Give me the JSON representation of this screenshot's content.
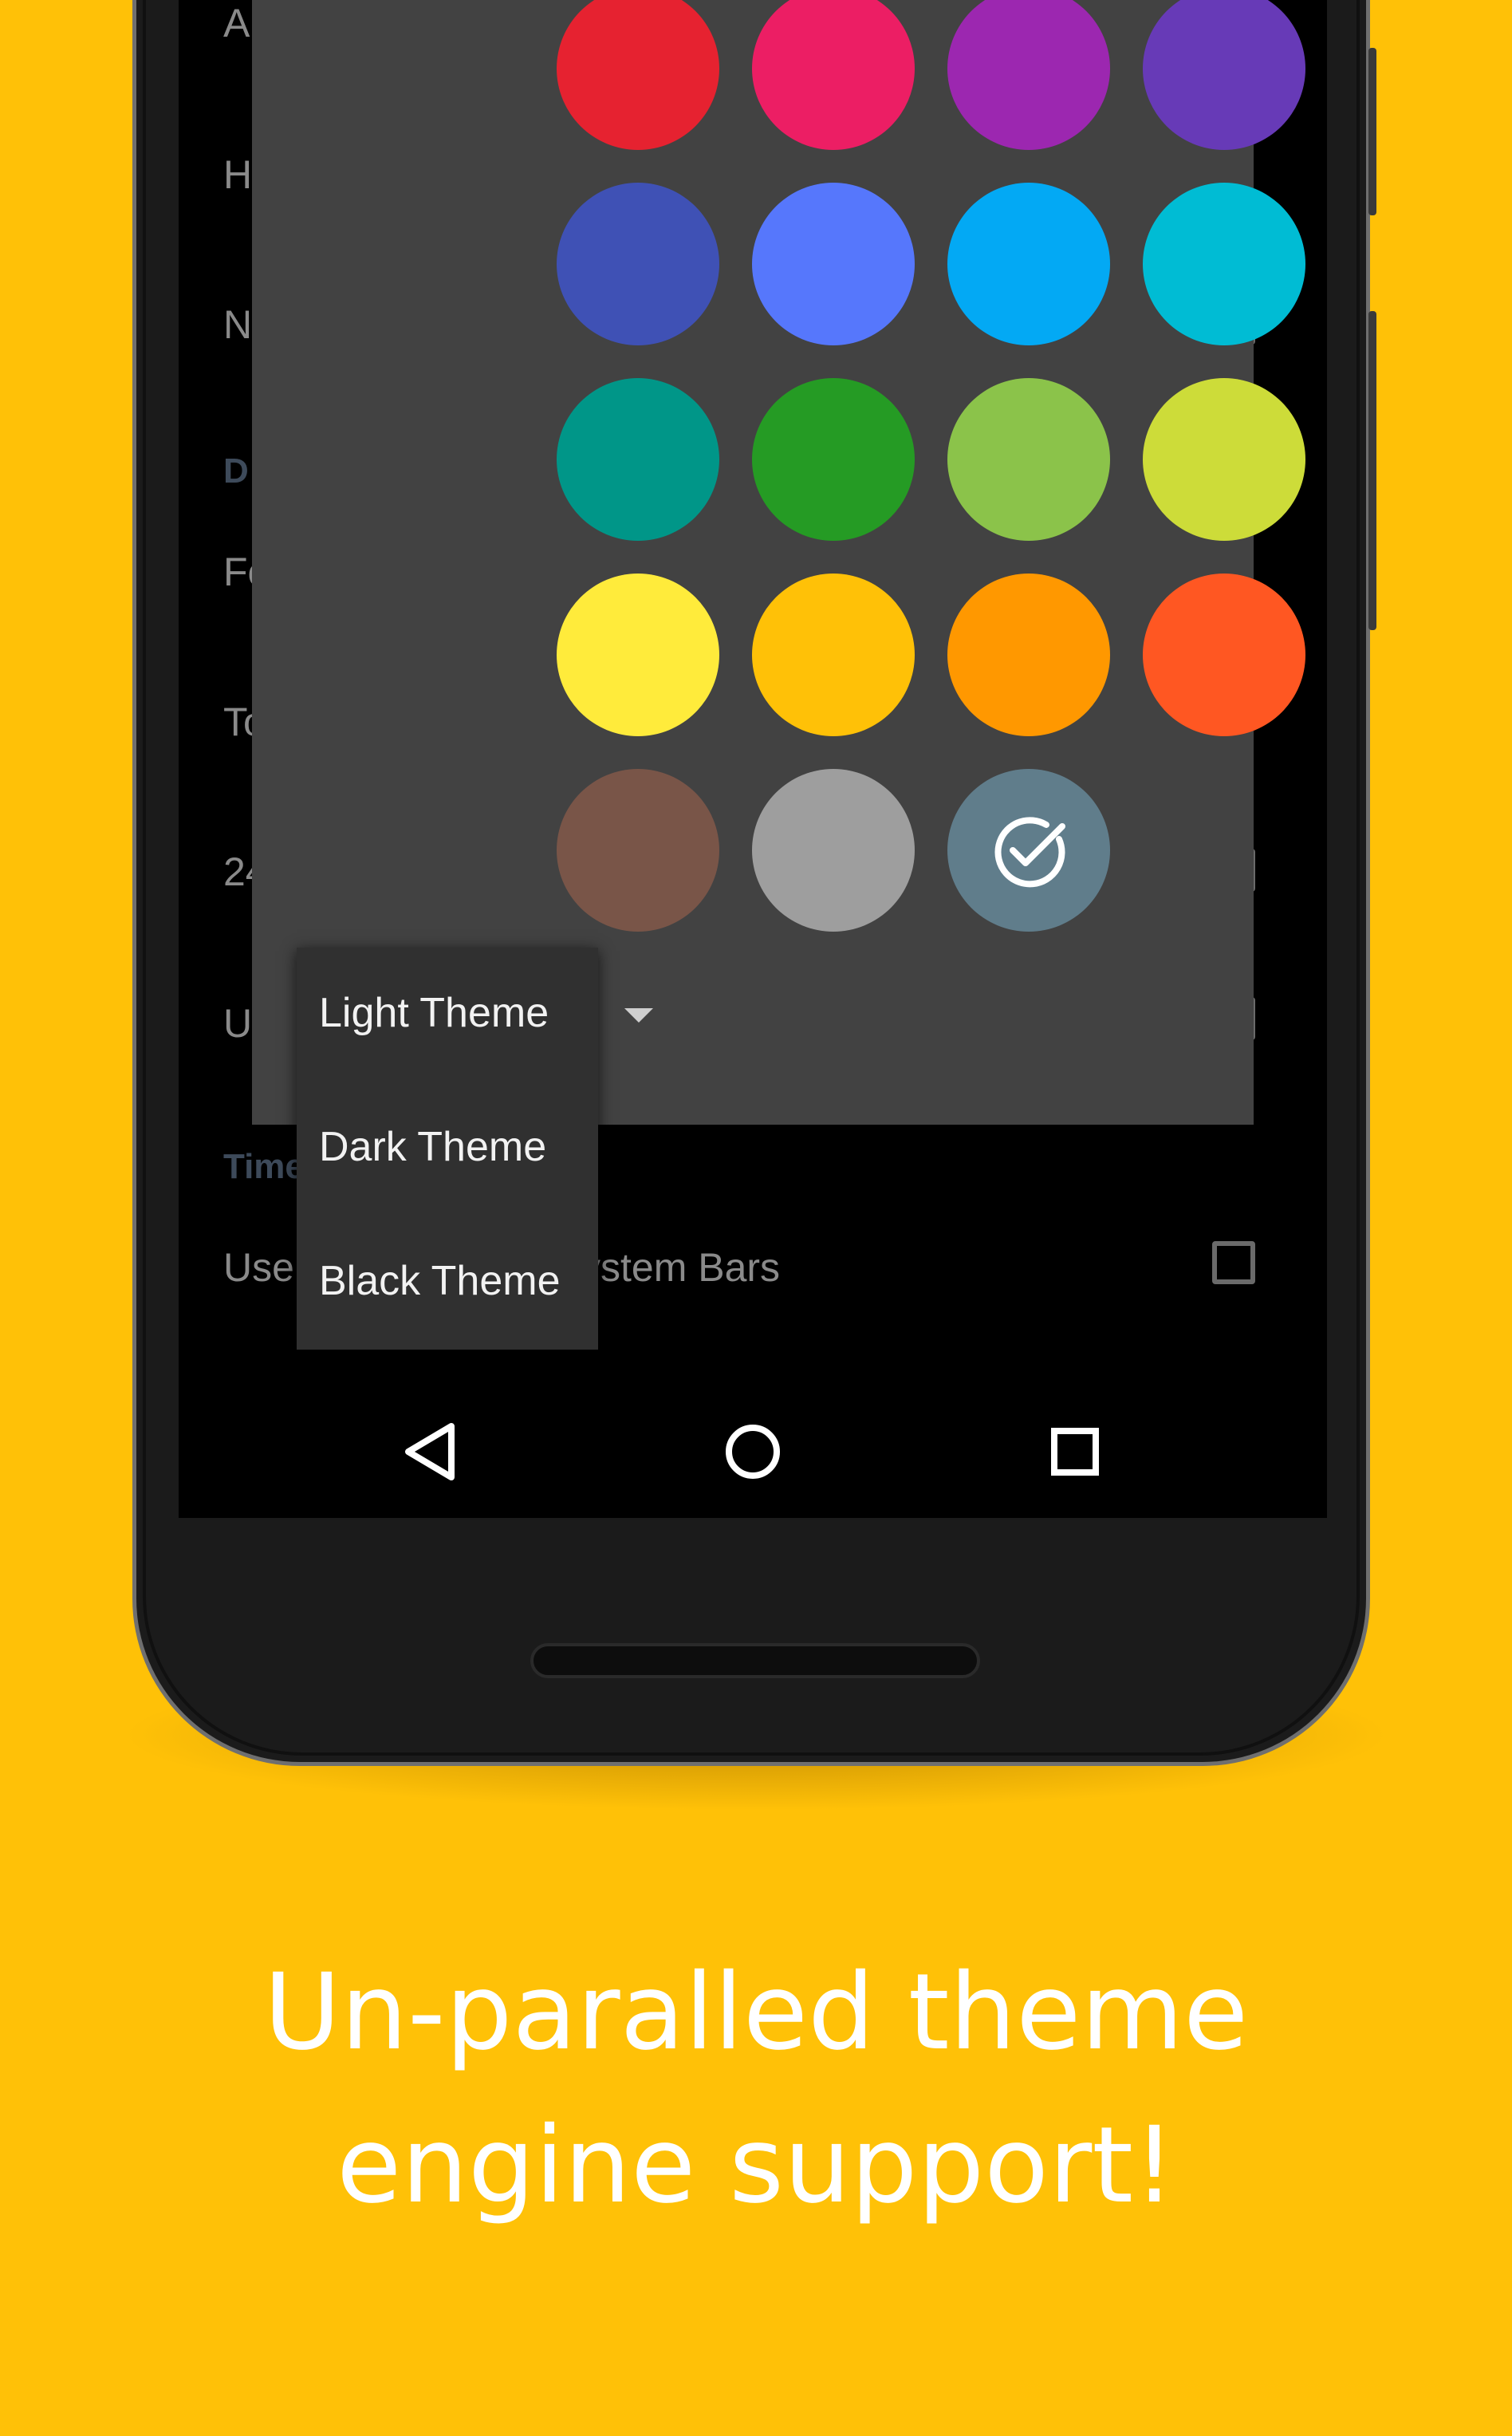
{
  "colors": {
    "background": "#FFC107",
    "dialog": "#424242",
    "menu": "#303030",
    "caption": "#FFFFFF"
  },
  "background_settings": {
    "rows": [
      {
        "text": "A"
      },
      {
        "text": "H"
      },
      {
        "text": "N"
      },
      {
        "text": "D"
      },
      {
        "text": "Fo"
      },
      {
        "text": "To"
      },
      {
        "text": "24"
      },
      {
        "text": "U"
      },
      {
        "text": "Time"
      },
      {
        "text": "Use",
        "suffix": "ystem Bars"
      }
    ]
  },
  "palette": {
    "swatches": [
      {
        "color": "#E62230",
        "name": "red"
      },
      {
        "color": "#EC1E64",
        "name": "pink"
      },
      {
        "color": "#9C27B0",
        "name": "purple"
      },
      {
        "color": "#673AB7",
        "name": "deep-purple"
      },
      {
        "color": "#3F51B5",
        "name": "indigo"
      },
      {
        "color": "#5677FC",
        "name": "blue"
      },
      {
        "color": "#03A9F4",
        "name": "light-blue"
      },
      {
        "color": "#00BCD4",
        "name": "cyan"
      },
      {
        "color": "#009688",
        "name": "teal"
      },
      {
        "color": "#259B24",
        "name": "green"
      },
      {
        "color": "#8BC34A",
        "name": "light-green"
      },
      {
        "color": "#CDDC39",
        "name": "lime"
      },
      {
        "color": "#FFEB3B",
        "name": "yellow"
      },
      {
        "color": "#FFC107",
        "name": "amber"
      },
      {
        "color": "#FF9800",
        "name": "orange"
      },
      {
        "color": "#FF5722",
        "name": "deep-orange"
      },
      {
        "color": "#795548",
        "name": "brown"
      },
      {
        "color": "#9E9E9E",
        "name": "grey"
      },
      {
        "color": "#607D8B",
        "name": "blue-grey",
        "selected": true
      }
    ]
  },
  "theme_menu": {
    "items": [
      "Light Theme",
      "Dark Theme",
      "Black Theme"
    ],
    "selected": "Light Theme"
  },
  "navbar": {
    "icons": [
      "back-icon",
      "home-icon",
      "recents-icon"
    ]
  },
  "caption": {
    "line1": "Un-paralled theme",
    "line2": "engine support!"
  }
}
